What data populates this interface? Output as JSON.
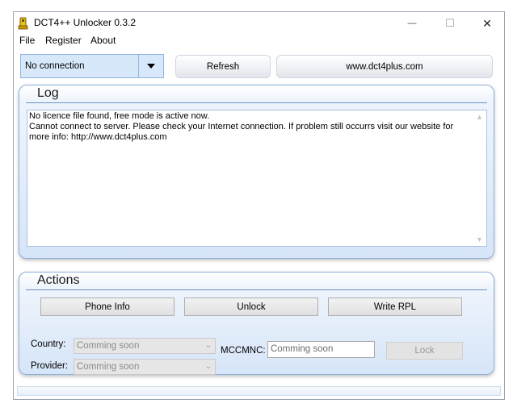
{
  "window": {
    "title": "DCT4++ Unlocker 0.3.2",
    "controls": {
      "minimize": "—",
      "maximize": "☐",
      "close": "✕"
    }
  },
  "menu": {
    "items": [
      "File",
      "Register",
      "About"
    ]
  },
  "toolbar": {
    "connection_value": "No connection",
    "refresh_label": "Refresh",
    "website_label": "www.dct4plus.com"
  },
  "log": {
    "title": "Log",
    "lines": [
      "No licence file found, free mode is active now.",
      "Cannot connect to server. Please check your Internet connection. If problem still occurrs visit our website for more info: http://www.dct4plus.com"
    ]
  },
  "actions": {
    "title": "Actions",
    "phone_info_label": "Phone Info",
    "unlock_label": "Unlock",
    "write_rpl_label": "Write RPL",
    "country_label": "Country:",
    "country_value": "Comming soon",
    "provider_label": "Provider:",
    "provider_value": "Comming soon",
    "mccmnc_label": "MCCMNC:",
    "mccmnc_value": "Comming soon",
    "lock_label": "Lock"
  },
  "colors": {
    "accent": "#d8e8fb",
    "group_border": "#8fb1dc"
  }
}
